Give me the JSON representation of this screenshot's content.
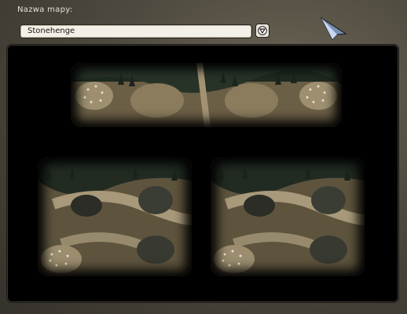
{
  "map_selector": {
    "label": "Nazwa mapy:",
    "selected_value": "Stonehenge",
    "dropdown_icon": "triangle-down-icon"
  },
  "preview": {
    "variants_shown": 3
  },
  "colors": {
    "background": "#4f4a3f",
    "field": "#f3f0e8",
    "terrain": "#6e6148",
    "panel": "#000000"
  }
}
